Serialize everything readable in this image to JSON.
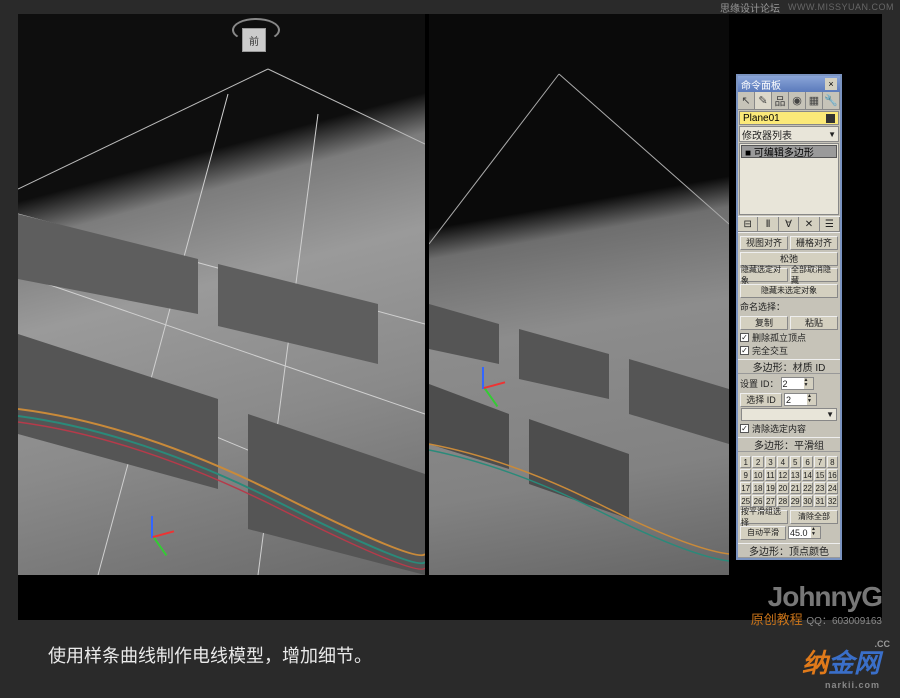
{
  "topbar": {
    "site": "思缘设计论坛",
    "url": "WWW.MISSYUAN.COM"
  },
  "cube_label": "前",
  "panel": {
    "title": "命令面板",
    "object_name": "Plane01",
    "modifier_dropdown": "修改器列表",
    "stack_item": "■ 可编辑多边形",
    "rollout_selection": {
      "btn_view_align": "视图对齐",
      "btn_mesh_align": "栅格对齐",
      "btn_shrink": "松弛",
      "btn_hide_sel": "隐藏选定对象",
      "btn_unhide_all": "全部取消隐藏",
      "btn_hide_unsel": "隐藏未选定对象",
      "named_sel_label": "命名选择：",
      "btn_copy": "复制",
      "btn_paste": "粘贴",
      "cb_delete_iso": "删除孤立顶点",
      "cb_full_inter": "完全交互"
    },
    "rollout_polygon": {
      "head": "多边形：材质 ID",
      "set_id_label": "设置 ID：",
      "set_id_val": "2",
      "sel_id_label": "选择 ID",
      "sel_id_val": "2",
      "cb_clear_sel": "清除选定内容"
    },
    "rollout_smoothing": {
      "head": "多边形：平滑组",
      "numbers": [
        "1",
        "2",
        "3",
        "4",
        "5",
        "6",
        "7",
        "8",
        "9",
        "10",
        "11",
        "12",
        "13",
        "14",
        "15",
        "16",
        "17",
        "18",
        "19",
        "20",
        "21",
        "22",
        "23",
        "24",
        "25",
        "26",
        "27",
        "28",
        "29",
        "30",
        "31",
        "32"
      ],
      "btn_by_smooth": "按平滑组选择",
      "btn_clear_all": "清除全部",
      "btn_auto": "自动平滑",
      "auto_val": "45.0"
    },
    "rollout_vcolor": {
      "head": "多边形：顶点颜色"
    }
  },
  "signature": {
    "name": "JohnnyG",
    "sub": "原创教程",
    "qq_label": "QQ：",
    "qq": "603009163"
  },
  "caption": "使用样条曲线制作电线模型，增加细节。",
  "logo": {
    "text1": "纳",
    "text2": "金网",
    "cc": ".CC",
    "sub": "narkii.com"
  }
}
